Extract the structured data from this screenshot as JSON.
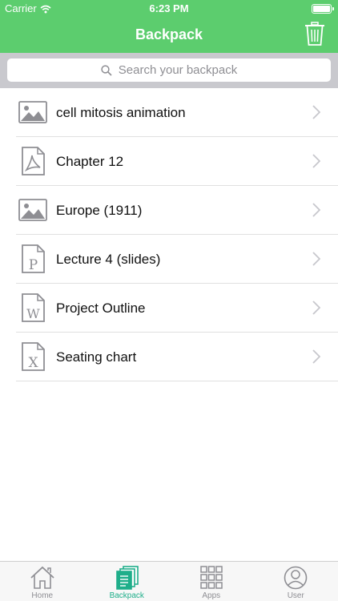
{
  "status_bar": {
    "carrier": "Carrier",
    "time": "6:23 PM"
  },
  "nav": {
    "title": "Backpack"
  },
  "search": {
    "placeholder": "Search your backpack"
  },
  "items": [
    {
      "label": "cell mitosis animation",
      "icon": "image-file-icon"
    },
    {
      "label": "Chapter 12",
      "icon": "pdf-file-icon"
    },
    {
      "label": "Europe (1911)",
      "icon": "image-file-icon"
    },
    {
      "label": "Lecture 4 (slides)",
      "icon": "powerpoint-file-icon"
    },
    {
      "label": "Project Outline",
      "icon": "word-file-icon"
    },
    {
      "label": "Seating chart",
      "icon": "excel-file-icon"
    }
  ],
  "tabs": [
    {
      "label": "Home",
      "icon": "home-icon",
      "active": false
    },
    {
      "label": "Backpack",
      "icon": "backpack-icon",
      "active": true
    },
    {
      "label": "Apps",
      "icon": "apps-grid-icon",
      "active": false
    },
    {
      "label": "User",
      "icon": "user-icon",
      "active": false
    }
  ],
  "colors": {
    "header_green": "#5ccd6e",
    "active_tab": "#1fae8a",
    "icon_gray": "#8e8e93"
  }
}
